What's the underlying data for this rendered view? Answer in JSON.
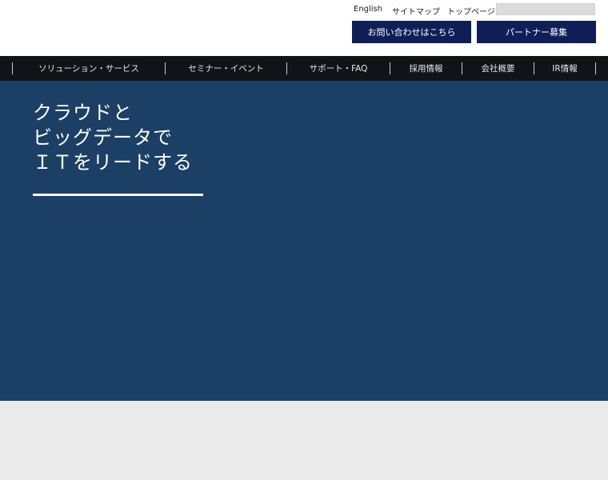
{
  "utility_links": {
    "english": "English",
    "sitemap": "サイトマップ",
    "top_page": "トップページ"
  },
  "search": {
    "value": "",
    "placeholder": ""
  },
  "cta": {
    "contact": "お問い合わせはこちら",
    "partner": "パートナー募集"
  },
  "nav": {
    "items": [
      {
        "label": "ソリューション・サービス"
      },
      {
        "label": "セミナー・イベント"
      },
      {
        "label": "サポート・FAQ"
      },
      {
        "label": "採用情報"
      },
      {
        "label": "会社概要"
      },
      {
        "label": "IR情報"
      }
    ]
  },
  "hero": {
    "lines": [
      "クラウドと",
      "ビッグデータで",
      "ＩＴをリードする"
    ]
  },
  "colors": {
    "cta_bg": "#0e1f57",
    "nav_bg": "#111417",
    "hero_bg": "#1c3f66",
    "page_bg": "#ebebeb"
  }
}
